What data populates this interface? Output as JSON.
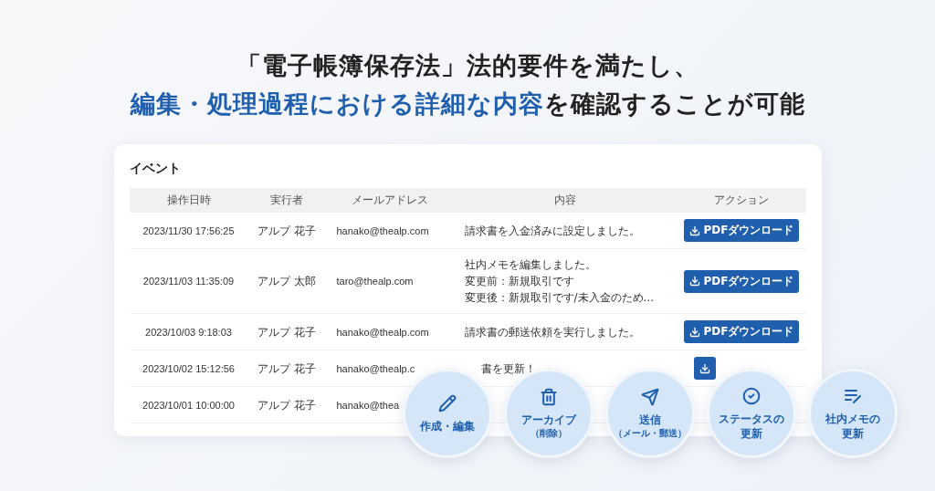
{
  "headline": {
    "line_1": [
      {
        "text": "「電子帳簿保存法」法的要件を満たし、",
        "highlight": false
      }
    ],
    "line_2": [
      {
        "text": "編集・処理過程における詳細な内容",
        "highlight": true
      },
      {
        "text": "を確認することが可能",
        "highlight": false
      }
    ]
  },
  "card": {
    "title": "イベント",
    "columns": [
      "操作日時",
      "実行者",
      "メールアドレス",
      "内容",
      "アクション"
    ],
    "rows": [
      {
        "date": "2023/11/30 17:56:25",
        "user": "アルプ 花子",
        "email": "hanako@thealp.com",
        "content": [
          "請求書を入金済みに設定しました。"
        ],
        "button": "PDFダウンロード"
      },
      {
        "date": "2023/11/03 11:35:09",
        "user": "アルプ 太郎",
        "email": "taro@thealp.com",
        "content": [
          "社内メモを編集しました。",
          "変更前：新規取引です",
          "変更後：新規取引です/未入金のため..."
        ],
        "button": "PDFダウンロード"
      },
      {
        "date": "2023/10/03 9:18:03",
        "user": "アルプ 花子",
        "email": "hanako@thealp.com",
        "content": [
          "請求書の郵送依頼を実行しました。"
        ],
        "button": "PDFダウンロード"
      },
      {
        "date": "2023/10/02 15:12:56",
        "user": "アルプ 花子",
        "email": "hanako@thealp.c",
        "content": [
          "書を更新！"
        ],
        "content_covered": true,
        "download_icon": true
      },
      {
        "date": "2023/10/01 10:00:00",
        "user": "アルプ 花子",
        "email": "hanako@thea",
        "content": []
      }
    ]
  },
  "features": [
    {
      "kind": "pencil",
      "lines": [
        {
          "text": "作成・編集",
          "kind": "main"
        }
      ]
    },
    {
      "kind": "trash",
      "lines": [
        {
          "text": "アーカイブ",
          "kind": "main"
        },
        {
          "text": "（削除）",
          "kind": "sub"
        }
      ]
    },
    {
      "kind": "send",
      "lines": [
        {
          "text": "送信",
          "kind": "main"
        },
        {
          "text": "（メール・郵送）",
          "kind": "sub"
        }
      ]
    },
    {
      "kind": "check",
      "lines": [
        {
          "text": "ステータスの",
          "kind": "main"
        },
        {
          "text": "更新",
          "kind": "main"
        }
      ]
    },
    {
      "kind": "memo",
      "lines": [
        {
          "text": "社内メモの",
          "kind": "main"
        },
        {
          "text": "更新",
          "kind": "main"
        }
      ]
    }
  ]
}
